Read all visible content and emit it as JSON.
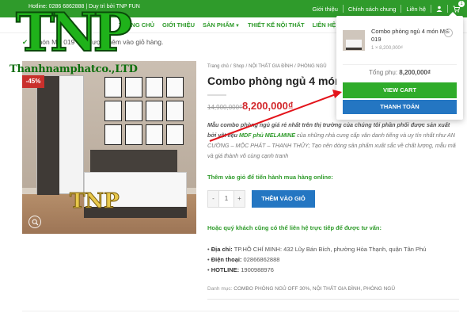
{
  "topbar": {
    "hotline": "Hotline: 0286 6862888 | Duy trì bởi TNP FUN",
    "links": [
      "Giới thiệu",
      "Chính sách chung",
      "Liên hệ"
    ],
    "cart_count": "1"
  },
  "nav": {
    "items": [
      {
        "label": "TRANG CHỦ",
        "caret": false
      },
      {
        "label": "GIỚI THIỆU",
        "caret": false
      },
      {
        "label": "SẢN PHẨM",
        "caret": true
      },
      {
        "label": "THIẾT KẾ NỘI THẤT",
        "caret": false
      },
      {
        "label": "LIÊN HỆ",
        "caret": false
      }
    ]
  },
  "logo": {
    "text": "TNP",
    "brand": "Thanhnamphatco.,LTD"
  },
  "notice": "4 món MS 019” đã được thêm vào giỏ hàng.",
  "product": {
    "sale_badge": "-45%",
    "watermark": "TNP",
    "breadcrumb": [
      "Trang chủ",
      "Shop",
      "NỘI THẤT GIA ĐÌNH",
      "PHÒNG NGỦ"
    ],
    "title": "Combo phòng ngủ 4 món MS 019",
    "old_price": "14,900,000₫",
    "new_price": "8,200,000₫",
    "desc_1": "Mẫu combo phòng ngủ giá rẻ nhất trên thị trường của chúng tôi phần phối được sản xuất bởi vật liệu ",
    "desc_highlight": "MDF phủ MELAMINE",
    "desc_2": " của những nhà cung cấp vân danh tiếng và uy tín nhất như ",
    "desc_brands": "AN CƯỜNG – MỘC PHÁT – THANH THỦY",
    "desc_3": "; Tạo nên dòng sản phẩm xuất sắc về chất lượng, mẫu mã và giá thành vô cùng cạnh tranh",
    "cta_text": "Thêm vào giỏ để tiến hành mua hàng online:",
    "qty_minus": "-",
    "qty_value": "1",
    "qty_plus": "+",
    "add_to_cart": "THÊM VÀO GIỎ",
    "contact_head": "Hoặc quý khách cũng có thể liên hệ trực tiếp để được tư vấn:",
    "address_label": "Địa chỉ:",
    "address": " TP.HỒ CHÍ MINH: 432 Lũy Bán Bích, phường Hòa Thạnh, quận Tân Phú",
    "phone_label": "Điện thoại:",
    "phone": " 02866862888",
    "hotline_label": "HOTLINE:",
    "hotline": " 1900988976",
    "categories_label": "Danh mục:",
    "categories": " COMBO PHÒNG NGỦ OFF 30%, NỘI THẤT GIA ĐÌNH, PHÒNG NGỦ"
  },
  "cart_popup": {
    "item_name": "Combo phòng ngủ 4 món MS 019",
    "item_meta": "1 × 8,200,000₫",
    "remove": "×",
    "total_label": "Tổng phụ:",
    "total_value": "8,200,000₫",
    "view_cart": "VIEW CART",
    "checkout": "THANH TOÁN"
  },
  "colors": {
    "brand_green": "#2f9b2b",
    "price_red": "#d2282c",
    "button_blue": "#2476c2"
  }
}
